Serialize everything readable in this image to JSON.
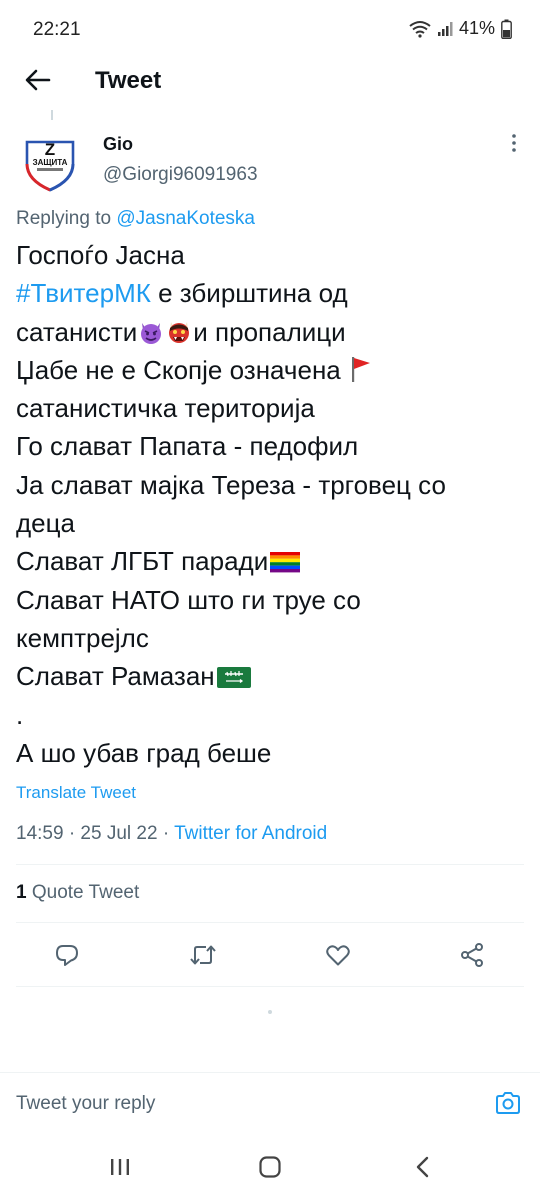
{
  "status_bar": {
    "time": "22:21",
    "battery": "41%"
  },
  "header": {
    "title": "Tweet",
    "back_icon": "arrow-left-icon"
  },
  "tweet": {
    "author_name": "Gio",
    "author_handle": "@Giorgi96091963",
    "avatar_text": "ЗАЩИТА",
    "replying_prefix": "Replying to ",
    "replying_to": "@JasnaKoteska",
    "lines": {
      "l1": "Госпоѓо Јасна",
      "l2_hashtag": "#ТвитерМК",
      "l2_rest": " е збирштина од",
      "l3_a": "сатанисти",
      "l3_b": "и пропалици",
      "l4": "Џабе не е Скопје означена ",
      "l5": "сатанистичка територија",
      "l6": "Го слават Папата - педофил",
      "l7": "Ја слават мајка Тереза - трговец со",
      "l8": "деца",
      "l9": "Слават ЛГБТ паради",
      "l10": "Слават НАТО што ги труе со",
      "l11": "кемптрејлс",
      "l12": "Слават Рамазан",
      "l13": ".",
      "l14": "А шо убав град беше"
    },
    "emojis": [
      "smiling-imp-icon",
      "japanese-ogre-icon",
      "red-flag-icon",
      "rainbow-flag-icon",
      "saudi-flag-icon"
    ],
    "translate_label": "Translate Tweet",
    "timestamp": "14:59 · 25 Jul 22 · ",
    "source": "Twitter for Android",
    "quote_count": "1",
    "quote_label": " Quote Tweet"
  },
  "actions": [
    "reply-icon",
    "retweet-icon",
    "like-icon",
    "share-icon"
  ],
  "reply_box": {
    "placeholder": "Tweet your reply"
  },
  "colors": {
    "accent": "#1d9bf0",
    "text": "#0f1419",
    "secondary": "#536471",
    "divider": "#eff3f4"
  }
}
